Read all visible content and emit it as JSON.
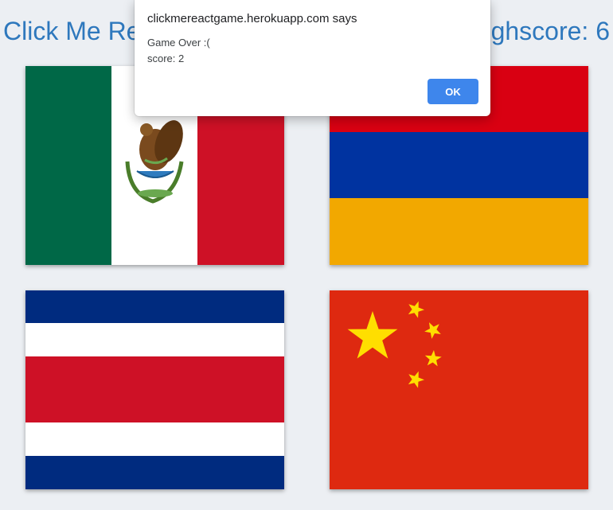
{
  "header": {
    "title": "Click Me React Game",
    "highscore_label": "Highscore: 6"
  },
  "flags": [
    {
      "name": "mexico-flag",
      "colors": [
        "#006847",
        "#ffffff",
        "#ce1126"
      ]
    },
    {
      "name": "armenia-flag",
      "colors": [
        "#d90012",
        "#0033a0",
        "#f2a800"
      ]
    },
    {
      "name": "costa-rica-flag",
      "colors": [
        "#002b7f",
        "#ffffff",
        "#ce1126"
      ]
    },
    {
      "name": "china-flag",
      "colors": [
        "#de2910",
        "#ffde00"
      ]
    }
  ],
  "dialog": {
    "origin": "clickmereactgame.herokuapp.com says",
    "message_line1": "Game Over :(",
    "message_line2": "score: 2",
    "ok_label": "OK"
  },
  "colors": {
    "accent": "#2e78bd",
    "button": "#3e86ec",
    "background": "#eceff3"
  }
}
